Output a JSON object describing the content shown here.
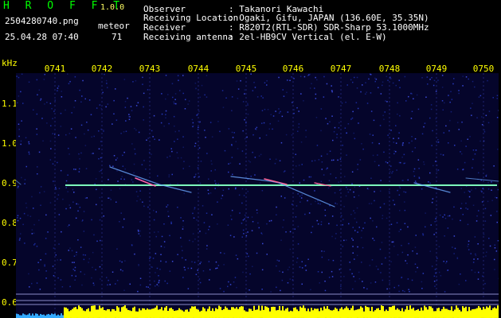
{
  "header": {
    "app_name": "H R O F F T",
    "version": "1.0.0",
    "filename": "2504280740.png",
    "timestamp": "25.04.28 07:40",
    "meteor_label": "meteor",
    "meteor_count": "71",
    "info_labels": [
      "Observer",
      "Receiving Location",
      "Receiver",
      "Receiving antenna"
    ],
    "info_values": [
      ": Takanori Kawachi",
      ": Ogaki, Gifu, JAPAN (136.60E, 35.35N)",
      ": R820T2(RTL-SDR) SDR-Sharp 53.1000MHz",
      ": 2el-HB9CV Vertical (el. E-W)"
    ]
  },
  "axis": {
    "unit": "kHz",
    "x_ticks": [
      "0741",
      "0742",
      "0743",
      "0744",
      "0745",
      "0746",
      "0747",
      "0748",
      "0749",
      "0750"
    ],
    "y_ticks": [
      "1.1",
      "1.0",
      "0.9",
      "0.8",
      "0.7",
      "0.6"
    ]
  },
  "colors": {
    "background": "#000000",
    "plot_bg": "#05052b",
    "carrier": "#66ffcc",
    "text_yellow": "#ffff00",
    "bar_yellow": "#ffff00"
  }
}
